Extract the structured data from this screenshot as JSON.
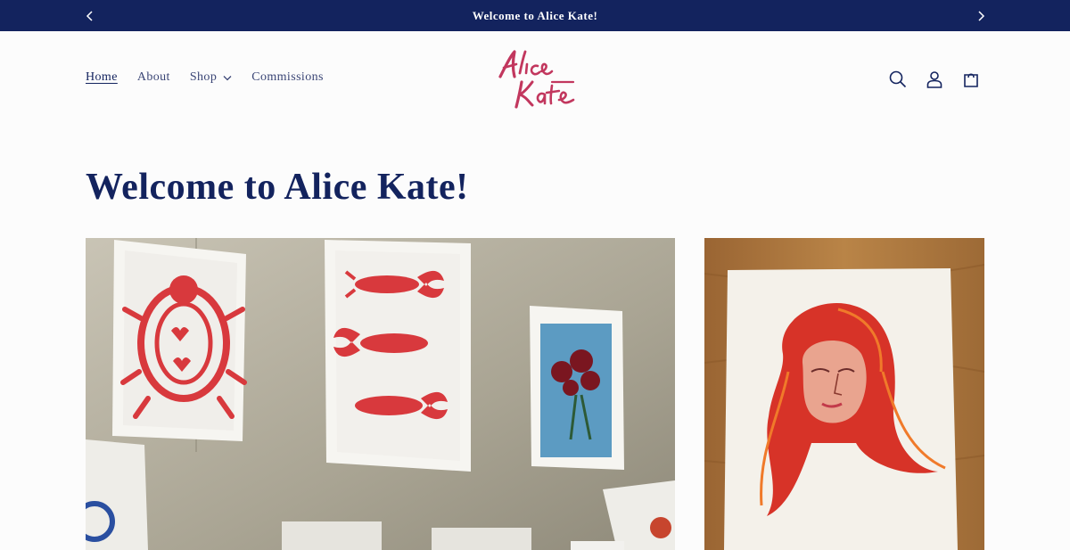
{
  "announcement": {
    "text": "Welcome to Alice Kate!",
    "prev_icon": "chevron-left-icon",
    "next_icon": "chevron-right-icon"
  },
  "nav": {
    "items": [
      {
        "label": "Home",
        "active": true
      },
      {
        "label": "About",
        "active": false
      },
      {
        "label": "Shop",
        "active": false,
        "dropdown": true
      },
      {
        "label": "Commissions",
        "active": false
      }
    ]
  },
  "logo": {
    "line1": "Alice",
    "line2": "Kate",
    "color": "#c2375e"
  },
  "header_icons": [
    "search-icon",
    "account-icon",
    "cart-icon"
  ],
  "main": {
    "title": "Welcome to Alice Kate!"
  },
  "colors": {
    "brand_navy": "#13235e",
    "accent_pink": "#c2375e"
  }
}
